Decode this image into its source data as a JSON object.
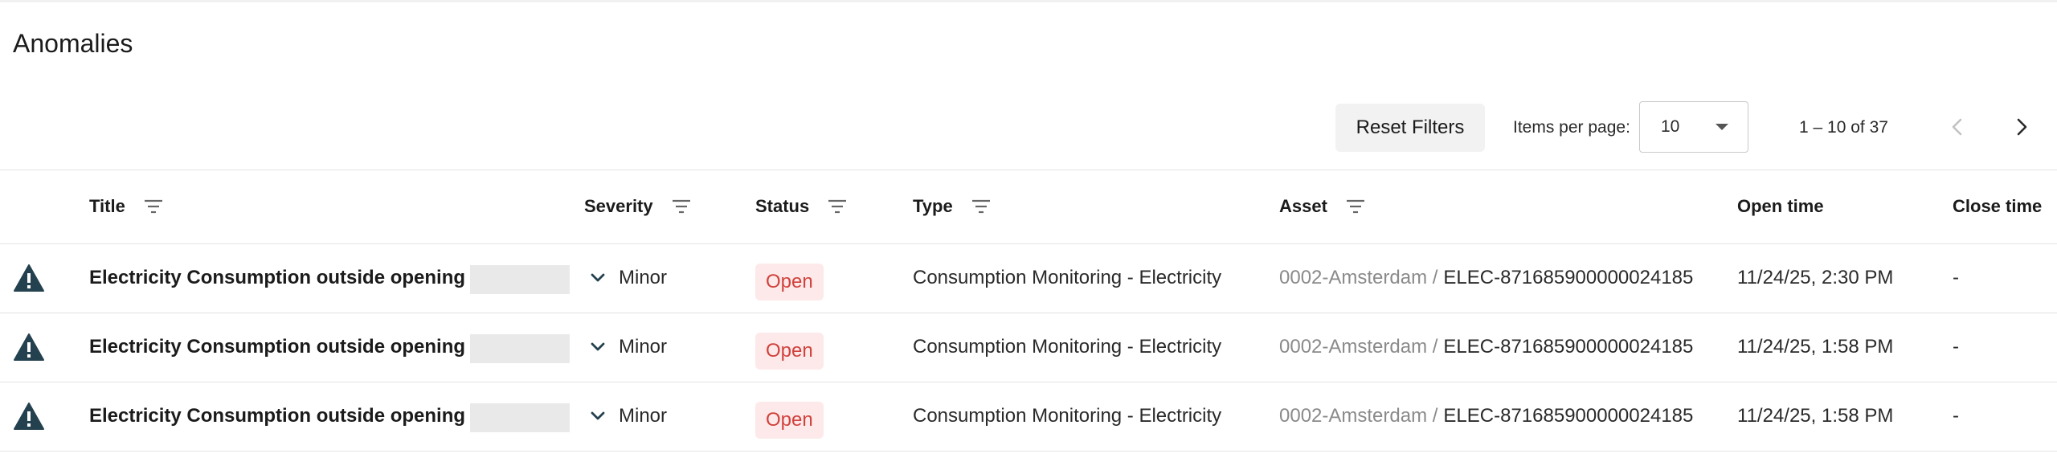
{
  "page": {
    "title": "Anomalies"
  },
  "toolbar": {
    "reset_label": "Reset Filters",
    "items_per_page_label": "Items per page:",
    "items_per_page_value": "10",
    "range_label": "1 – 10 of 37"
  },
  "columns": {
    "title": "Title",
    "severity": "Severity",
    "status": "Status",
    "type": "Type",
    "asset": "Asset",
    "open_time": "Open time",
    "close_time": "Close time"
  },
  "rows": [
    {
      "title": "Electricity Consumption outside opening",
      "severity": "Minor",
      "status": "Open",
      "type": "Consumption Monitoring - Electricity",
      "asset_site": "0002-Amsterdam /",
      "asset_id": "ELEC-871685900000024185",
      "open_time": "11/24/25, 2:30 PM",
      "close_time": "-"
    },
    {
      "title": "Electricity Consumption outside opening",
      "severity": "Minor",
      "status": "Open",
      "type": "Consumption Monitoring - Electricity",
      "asset_site": "0002-Amsterdam /",
      "asset_id": "ELEC-871685900000024185",
      "open_time": "11/24/25, 1:58 PM",
      "close_time": "-"
    },
    {
      "title": "Electricity Consumption outside opening",
      "severity": "Minor",
      "status": "Open",
      "type": "Consumption Monitoring - Electricity",
      "asset_site": "0002-Amsterdam /",
      "asset_id": "ELEC-871685900000024185",
      "open_time": "11/24/25, 1:58 PM",
      "close_time": "-"
    }
  ],
  "icons": {
    "warning": "warning-triangle-icon",
    "filter": "filter-icon",
    "chevron": "chevron-down-icon",
    "prev": "chevron-left-icon",
    "next": "chevron-right-icon",
    "caret": "caret-down-icon"
  },
  "colors": {
    "warning_icon": "#24414f",
    "status_text": "#d0413c",
    "status_bg": "#fde9e9",
    "button_bg": "#f2f2f2",
    "muted_text": "#8a8a8a"
  }
}
